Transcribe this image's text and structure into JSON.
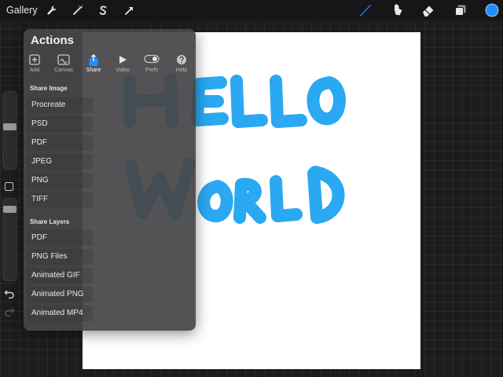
{
  "topbar": {
    "gallery_label": "Gallery",
    "tools": [
      "wrench-icon",
      "magic-wand-icon",
      "selection-s-icon",
      "transform-arrow-icon"
    ],
    "right_tools": [
      "brush-icon",
      "smudge-icon",
      "eraser-icon",
      "layers-icon",
      "color-swatch"
    ],
    "active_color": "#1e90ff",
    "brush_color": "#2a7cff"
  },
  "canvas": {
    "ink_color": "#2aa8f2",
    "paper_color": "#ffffff"
  },
  "actions": {
    "title": "Actions",
    "tabs": [
      {
        "label": "Add",
        "icon": "add-icon"
      },
      {
        "label": "Canvas",
        "icon": "canvas-icon"
      },
      {
        "label": "Share",
        "icon": "share-icon"
      },
      {
        "label": "Video",
        "icon": "video-icon"
      },
      {
        "label": "Prefs",
        "icon": "prefs-toggle-icon"
      },
      {
        "label": "Help",
        "icon": "help-icon"
      }
    ],
    "active_tab": "Share",
    "share_image": {
      "title": "Share Image",
      "items": [
        "Procreate",
        "PSD",
        "PDF",
        "JPEG",
        "PNG",
        "TIFF"
      ]
    },
    "share_layers": {
      "title": "Share Layers",
      "items": [
        "PDF",
        "PNG Files",
        "Animated GIF",
        "Animated PNG",
        "Animated MP4"
      ]
    }
  }
}
